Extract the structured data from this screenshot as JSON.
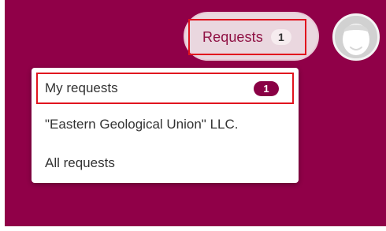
{
  "header": {
    "requests_label": "Requests",
    "requests_count": "1"
  },
  "dropdown": {
    "items": [
      {
        "label": "My requests",
        "badge": "1"
      },
      {
        "label": "\"Eastern Geological Union\" LLC."
      },
      {
        "label": "All requests"
      }
    ]
  },
  "colors": {
    "background": "#900048",
    "pill": "#ead7df",
    "highlight": "#e1141e",
    "badge": "#8a0045"
  },
  "icons": {
    "avatar": "user-avatar-icon"
  }
}
